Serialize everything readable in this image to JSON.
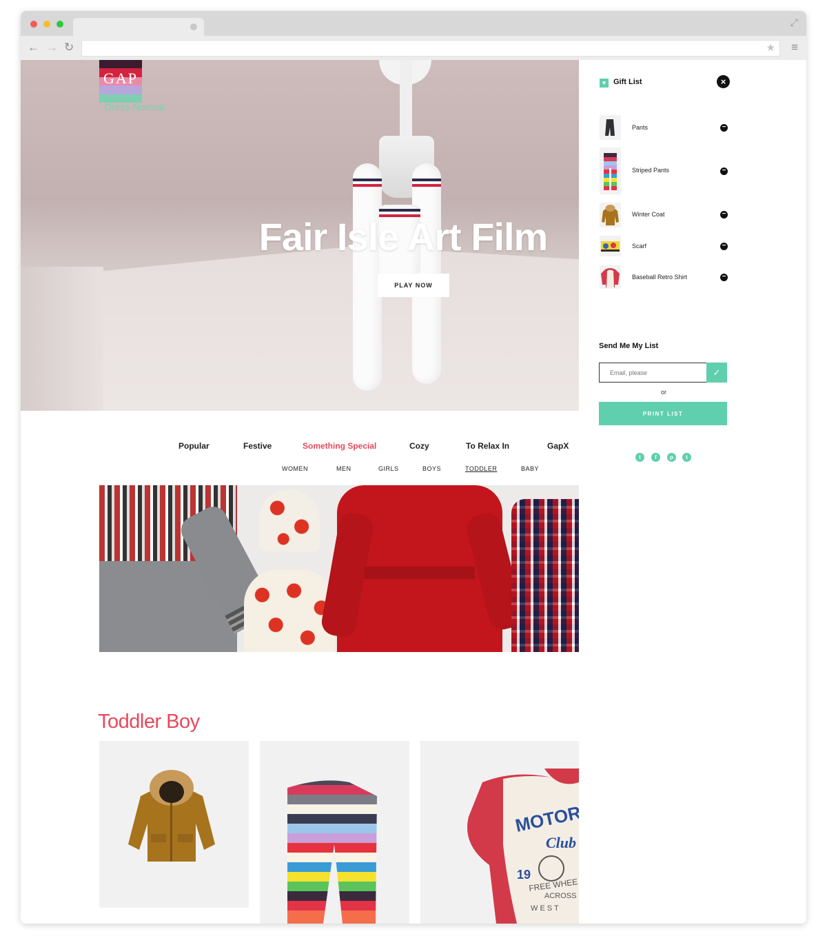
{
  "brand": {
    "logo_text": "GAP",
    "tagline": "Dress Normal.",
    "logo_colors": [
      "#3a1b2f",
      "#d2233f",
      "#e98aa6",
      "#b7a6dc",
      "#7ecfb0"
    ]
  },
  "hero": {
    "title": "Fair Isle Art Film",
    "button_label": "PLAY NOW"
  },
  "categories": [
    "Popular",
    "Festive",
    "Something Special",
    "Cozy",
    "To Relax In",
    "GapX"
  ],
  "active_category": "Something Special",
  "subcategories": [
    "WOMEN",
    "MEN",
    "GIRLS",
    "BOYS",
    "TODDLER",
    "BABY"
  ],
  "active_subcategory": "TODDLER",
  "section": {
    "title": "Toddler Boy"
  },
  "shirt_graphic": {
    "line1": "MOTORC",
    "line2": "Club",
    "number": "19",
    "line3": "FREE WHEE",
    "line4": "ACROSS",
    "line5": "W E S T"
  },
  "gift_list": {
    "title": "Gift List",
    "items": [
      {
        "name": "Pants"
      },
      {
        "name": "Striped Pants"
      },
      {
        "name": "Winter Coat"
      },
      {
        "name": "Scarf"
      },
      {
        "name": "Baseball Retro Shirt"
      }
    ],
    "send_title": "Send Me My List",
    "email_placeholder": "Email, please",
    "or_text": "or",
    "print_label": "PRINT LIST"
  },
  "social_icons": [
    "twitter-icon",
    "facebook-icon",
    "pinterest-icon",
    "tumblr-icon"
  ],
  "colors": {
    "accent": "#5fcfae",
    "highlight": "#e8485a",
    "text": "#222222"
  }
}
